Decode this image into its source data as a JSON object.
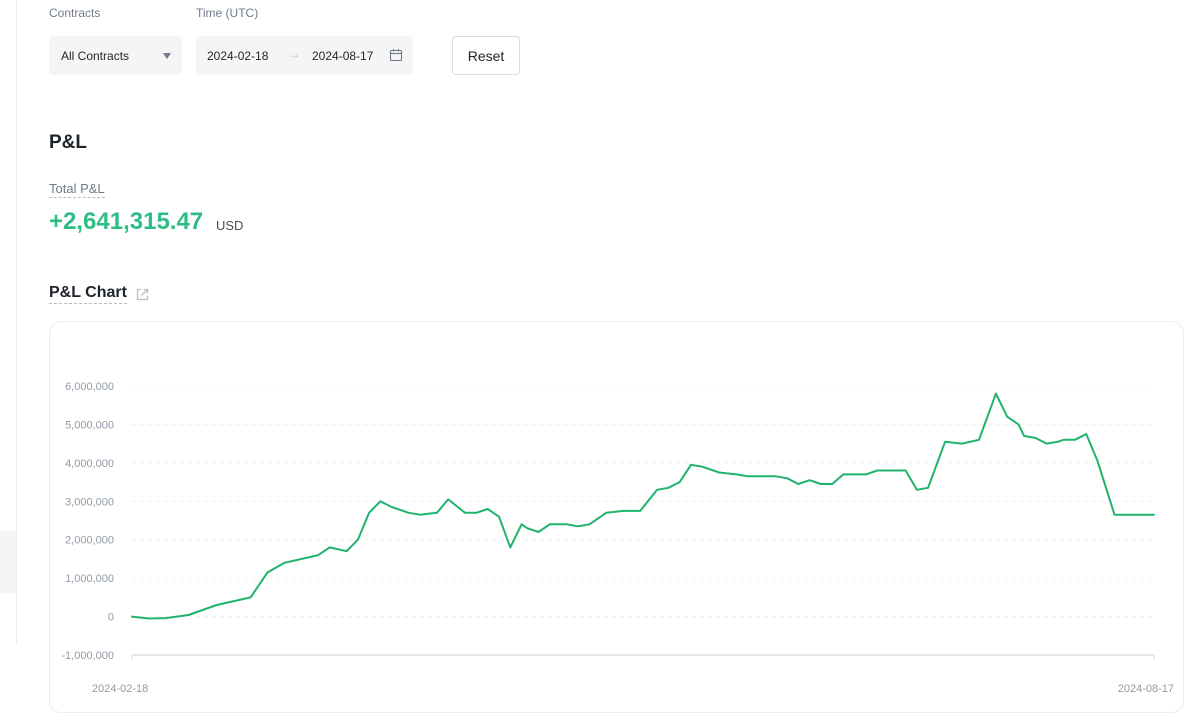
{
  "filters": {
    "contracts_label": "Contracts",
    "contracts_value": "All Contracts",
    "time_label": "Time (UTC)",
    "date_start": "2024-02-18",
    "date_separator": "→",
    "date_end": "2024-08-17",
    "reset_label": "Reset"
  },
  "pnl": {
    "section_title": "P&L",
    "total_label": "Total P&L",
    "total_value": "+2,641,315.47",
    "total_unit": "USD",
    "chart_title": "P&L Chart"
  },
  "colors": {
    "positive": "#2ebd85",
    "line": "#1fb36c",
    "muted": "#929aa5"
  },
  "chart_data": {
    "type": "line",
    "x_tick_labels": [
      "2024-02-18",
      "2024-08-17"
    ],
    "ylim": [
      -1000000,
      6000000
    ],
    "y_ticks": [
      -1000000,
      0,
      1000000,
      2000000,
      3000000,
      4000000,
      5000000,
      6000000
    ],
    "y_tick_labels": [
      "-1,000,000",
      "0",
      "1,000,000",
      "2,000,000",
      "3,000,000",
      "4,000,000",
      "5,000,000",
      "6,000,000"
    ],
    "grid": true,
    "x_days": 181,
    "series": [
      {
        "x": [
          0,
          3,
          6,
          10,
          15,
          21,
          24,
          27,
          33,
          35,
          38,
          40,
          42,
          44,
          46,
          49,
          51,
          54,
          56,
          59,
          61,
          63,
          65,
          67,
          69,
          70,
          72,
          74,
          77,
          79,
          81,
          84,
          87,
          90,
          93,
          95,
          97,
          99,
          101,
          104,
          107,
          109,
          111,
          114,
          116,
          118,
          120,
          122,
          124,
          126,
          128,
          130,
          132,
          134,
          136,
          137,
          139,
          141,
          144,
          147,
          150,
          153,
          155,
          157,
          158,
          160,
          162,
          164,
          165,
          167,
          169,
          171,
          174,
          175,
          177,
          179,
          181
        ],
        "values": [
          0,
          -50000,
          -40000,
          40000,
          300000,
          500000,
          1150000,
          1400000,
          1600000,
          1800000,
          1700000,
          2000000,
          2700000,
          3000000,
          2850000,
          2700000,
          2650000,
          2700000,
          3050000,
          2700000,
          2700000,
          2800000,
          2600000,
          1800000,
          2400000,
          2300000,
          2200000,
          2400000,
          2400000,
          2350000,
          2400000,
          2700000,
          2750000,
          2750000,
          3300000,
          3350000,
          3500000,
          3950000,
          3900000,
          3750000,
          3700000,
          3650000,
          3650000,
          3650000,
          3600000,
          3450000,
          3550000,
          3450000,
          3450000,
          3700000,
          3700000,
          3700000,
          3800000,
          3800000,
          3800000,
          3800000,
          3300000,
          3350000,
          4550000,
          4500000,
          4600000,
          5800000,
          5200000,
          5000000,
          4700000,
          4650000,
          4500000,
          4550000,
          4600000,
          4600000,
          4750000,
          4050000,
          2650000,
          2650000,
          2650000,
          2650000,
          2650000
        ]
      }
    ]
  }
}
